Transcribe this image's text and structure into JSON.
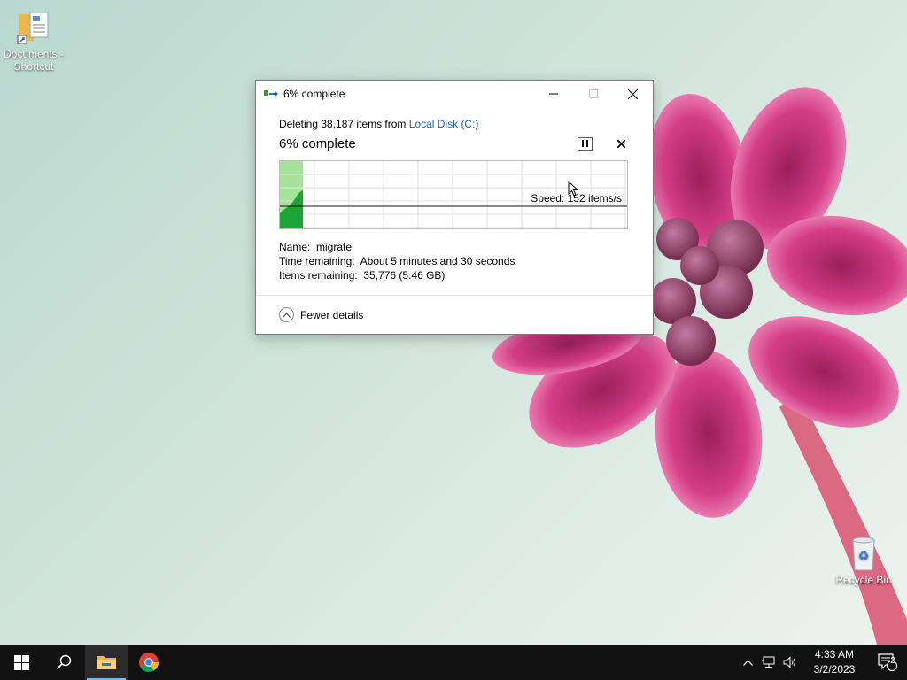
{
  "desktop": {
    "icons": [
      {
        "label": "Documents - Shortcut"
      },
      {
        "label": "Recycle Bin"
      }
    ]
  },
  "dialog": {
    "title": "6% complete",
    "deleting_prefix": "Deleting 38,187 items from ",
    "location_link": "Local Disk (C:)",
    "heading": "6% complete",
    "progress_fraction": 0.06,
    "speed": "Speed: 152 items/s",
    "name_label": "Name:",
    "name_value": "migrate",
    "time_label": "Time remaining:",
    "time_value": "About 5 minutes and 30 seconds",
    "items_label": "Items remaining:",
    "items_value": "35,776 (5.46 GB)",
    "toggle_label": "Fewer details"
  },
  "taskbar": {
    "time": "4:33 AM",
    "date": "3/2/2023",
    "notification_count": "2"
  },
  "colors": {
    "taskbar_bg": "#121212",
    "link": "#1a62a8",
    "progress_fill": "#a6e39a",
    "speed_graph": "#1aa534"
  }
}
